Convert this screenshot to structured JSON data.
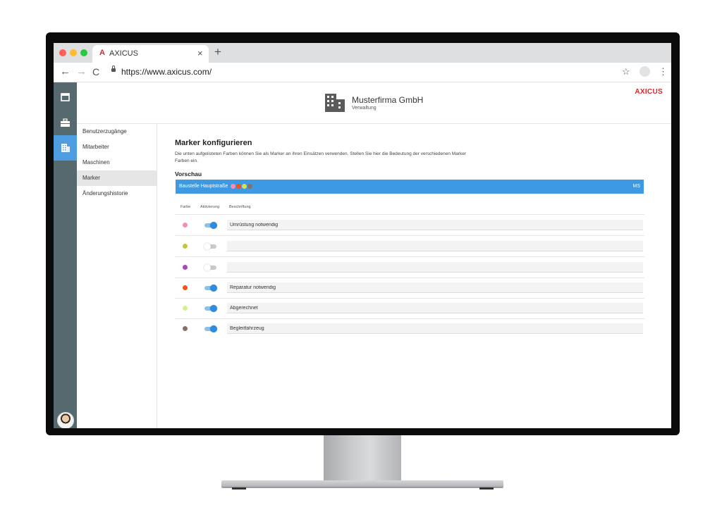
{
  "browser": {
    "tab_logo": "A",
    "tab_title": "AXICUS",
    "tab_close": "×",
    "new_tab": "+",
    "back": "←",
    "forward": "→",
    "reload": "C",
    "url": "https://www.axicus.com/",
    "star": "☆",
    "menu": "⋮"
  },
  "header": {
    "company_name": "Musterfirma GmbH",
    "company_sub": "Verwaltung",
    "brand": "AXICUS"
  },
  "rail": {
    "items": [
      {
        "icon": "calendar-icon",
        "active": false
      },
      {
        "icon": "briefcase-icon",
        "active": false
      },
      {
        "icon": "building-icon",
        "active": true
      }
    ]
  },
  "sidenav": {
    "items": [
      {
        "label": "Benutzerzugänge",
        "active": false
      },
      {
        "label": "Mitarbeiter",
        "active": false
      },
      {
        "label": "Maschinen",
        "active": false
      },
      {
        "label": "Marker",
        "active": true
      },
      {
        "label": "Änderungshistorie",
        "active": false
      }
    ]
  },
  "main": {
    "title": "Marker konfigurieren",
    "description": "Die unten aufgelisteten Farben können Sie als Marker an ihren Einsätzen verwenden. Stellen Sie hier die Bedeutung der verschiedenen Marker Farben ein.",
    "preview_label": "Vorschau",
    "preview": {
      "text": "Baustelle Hauptstraße",
      "dot_colors": [
        "#f48fb1",
        "#f4511e",
        "#d4e157",
        "#8d6e63"
      ],
      "initials": "MS"
    },
    "columns": {
      "color": "Farbe",
      "activation": "Aktivierung",
      "label": "Beschriftung"
    },
    "markers": [
      {
        "color": "#f48fb1",
        "active": true,
        "label": "Umrüstung notwendig"
      },
      {
        "color": "#c0ca33",
        "active": false,
        "label": ""
      },
      {
        "color": "#ab47bc",
        "active": false,
        "label": ""
      },
      {
        "color": "#f4511e",
        "active": true,
        "label": "Reparatur notwendig"
      },
      {
        "color": "#d4f08c",
        "active": true,
        "label": "Abgerechnet"
      },
      {
        "color": "#8d6e63",
        "active": true,
        "label": "Begleitfahrzeug"
      }
    ]
  },
  "colors": {
    "rail": "#55696f",
    "accent": "#3e99e3",
    "brand": "#d2272d"
  }
}
